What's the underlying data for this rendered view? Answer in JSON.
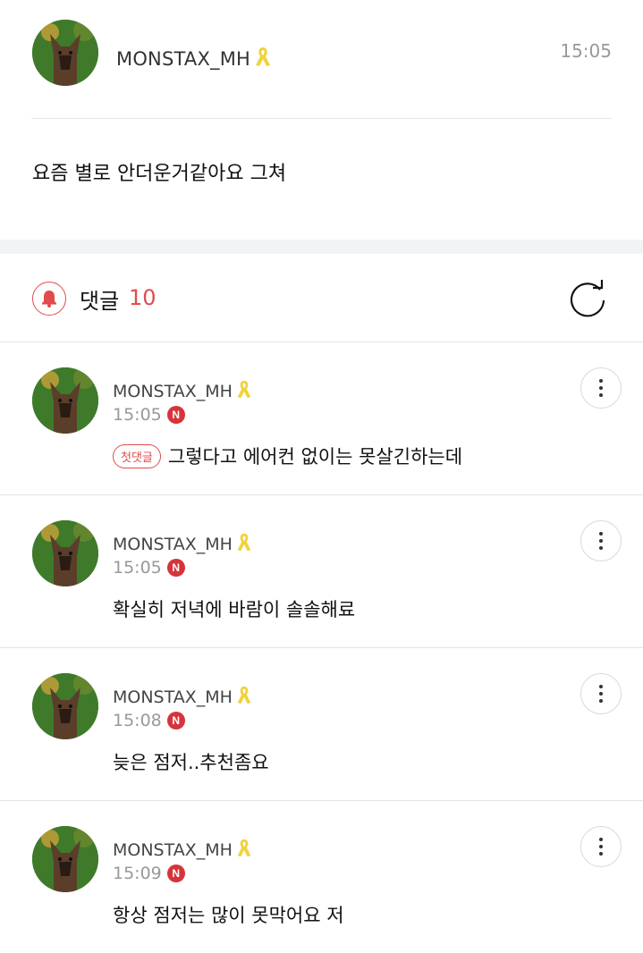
{
  "post": {
    "author": "MONSTAX_MH",
    "time": "15:05",
    "body": "요즘 별로 안더운거같아요 그쳐"
  },
  "comments_section": {
    "title": "댓글",
    "count": "10",
    "icon": "bell-icon",
    "refresh_icon": "refresh-icon"
  },
  "comments": [
    {
      "author": "MONSTAX_MH",
      "time": "15:05",
      "badge": "N",
      "first_label": "첫댓글",
      "text": "그렇다고 에어컨 없이는 못살긴하는데"
    },
    {
      "author": "MONSTAX_MH",
      "time": "15:05",
      "badge": "N",
      "text": "확실히 저녁에 바람이 솔솔해료"
    },
    {
      "author": "MONSTAX_MH",
      "time": "15:08",
      "badge": "N",
      "text": "늦은 점저..추천좀요"
    },
    {
      "author": "MONSTAX_MH",
      "time": "15:09",
      "badge": "N",
      "text": "항상 점저는 많이 못막어요 저"
    }
  ],
  "colors": {
    "accent": "#e14b4b",
    "badge": "#d6343a",
    "ribbon": "#f2d23a",
    "divider": "#e4e4e4",
    "section_gap": "#f2f3f5"
  }
}
